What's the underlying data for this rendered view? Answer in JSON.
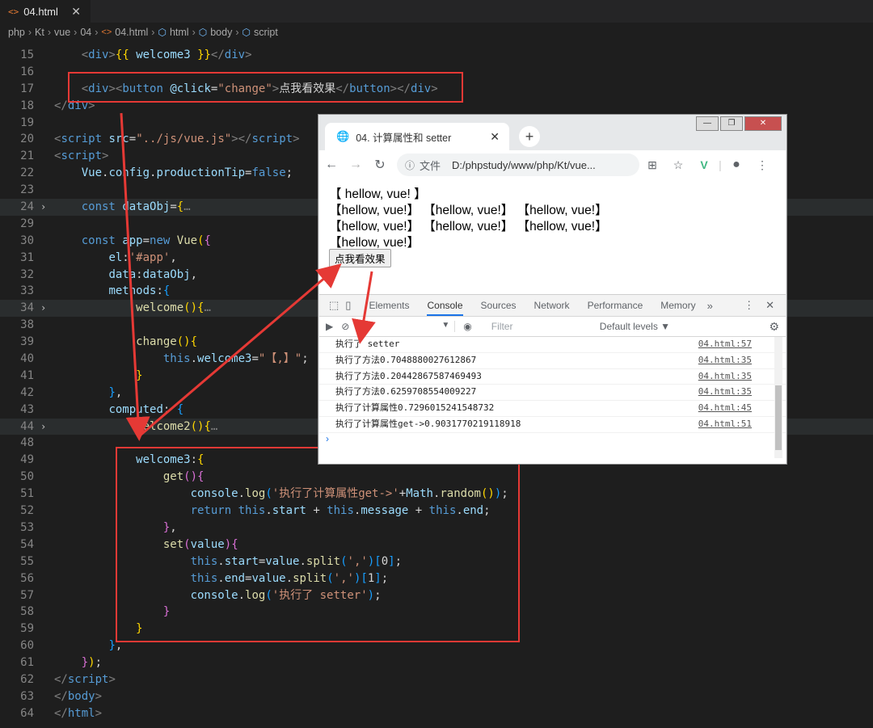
{
  "editor": {
    "tab_label": "04.html",
    "tab_close": "✕",
    "breadcrumb": [
      "php",
      "Kt",
      "vue",
      "04",
      "04.html",
      "html",
      "body",
      "script"
    ]
  },
  "code_lines": [
    {
      "n": "15",
      "fold": "",
      "hl": false,
      "html": "    <span class='tg'>&lt;</span><span class='tn'>div</span><span class='tg'>&gt;</span><span class='br'>{{</span> <span class='id'>welcome3</span> <span class='br'>}}</span><span class='tg'>&lt;/</span><span class='tn'>div</span><span class='tg'>&gt;</span>"
    },
    {
      "n": "16",
      "fold": "",
      "hl": false,
      "html": ""
    },
    {
      "n": "17",
      "fold": "",
      "hl": false,
      "html": "    <span class='tg'>&lt;</span><span class='tn'>div</span><span class='tg'>&gt;&lt;</span><span class='tn'>button</span> <span class='at'>@click</span>=<span class='st'>\"change\"</span><span class='tg'>&gt;</span>点我看效果<span class='tg'>&lt;/</span><span class='tn'>button</span><span class='tg'>&gt;&lt;/</span><span class='tn'>div</span><span class='tg'>&gt;</span>"
    },
    {
      "n": "18",
      "fold": "",
      "hl": false,
      "html": "<span class='tg'>&lt;/</span><span class='tn'>div</span><span class='tg'>&gt;</span>"
    },
    {
      "n": "19",
      "fold": "",
      "hl": false,
      "html": ""
    },
    {
      "n": "20",
      "fold": "",
      "hl": false,
      "html": "<span class='tg'>&lt;</span><span class='tn'>script</span> <span class='at'>src</span>=<span class='st'>\"../js/vue.js\"</span><span class='tg'>&gt;&lt;/</span><span class='tn'>script</span><span class='tg'>&gt;</span>"
    },
    {
      "n": "21",
      "fold": "",
      "hl": false,
      "html": "<span class='tg'>&lt;</span><span class='tn'>script</span><span class='tg'>&gt;</span>"
    },
    {
      "n": "22",
      "fold": "",
      "hl": false,
      "html": "    <span class='id'>Vue</span>.<span class='id'>config</span>.<span class='id'>productionTip</span>=<span class='kw'>false</span>;"
    },
    {
      "n": "23",
      "fold": "",
      "hl": false,
      "html": ""
    },
    {
      "n": "24",
      "fold": "›",
      "hl": true,
      "html": "    <span class='kw'>const</span> <span class='id'>dataObj</span>=<span class='br'>{</span><span class='cm'>…</span>"
    },
    {
      "n": "29",
      "fold": "",
      "hl": false,
      "html": ""
    },
    {
      "n": "30",
      "fold": "",
      "hl": false,
      "html": "    <span class='kw'>const</span> <span class='id'>app</span>=<span class='kw'>new</span> <span class='fn'>Vue</span><span class='br'>(</span><span class='br2'>{</span>"
    },
    {
      "n": "31",
      "fold": "",
      "hl": false,
      "html": "        <span class='id'>el</span>:<span class='st'>'#app'</span>,"
    },
    {
      "n": "32",
      "fold": "",
      "hl": false,
      "html": "        <span class='id'>data</span>:<span class='id'>dataObj</span>,"
    },
    {
      "n": "33",
      "fold": "",
      "hl": false,
      "html": "        <span class='id'>methods</span>:<span class='br3'>{</span>"
    },
    {
      "n": "34",
      "fold": "›",
      "hl": true,
      "html": "            <span class='fn'>welcome</span><span class='br'>()</span><span class='br'>{</span><span class='cm'>…</span>"
    },
    {
      "n": "38",
      "fold": "",
      "hl": false,
      "html": ""
    },
    {
      "n": "39",
      "fold": "",
      "hl": false,
      "html": "            <span class='fn'>change</span><span class='br'>()</span><span class='br'>{</span>"
    },
    {
      "n": "40",
      "fold": "",
      "hl": false,
      "html": "                <span class='kw'>this</span>.<span class='id'>welcome3</span>=<span class='st'>\"【,】\"</span>;"
    },
    {
      "n": "41",
      "fold": "",
      "hl": false,
      "html": "            <span class='br'>}</span>"
    },
    {
      "n": "42",
      "fold": "",
      "hl": false,
      "html": "        <span class='br3'>}</span>,"
    },
    {
      "n": "43",
      "fold": "",
      "hl": false,
      "html": "        <span class='id'>computed</span>: <span class='br3'>{</span>"
    },
    {
      "n": "44",
      "fold": "›",
      "hl": true,
      "html": "            <span class='fn'>welcome2</span><span class='br'>()</span><span class='br'>{</span><span class='cm'>…</span>"
    },
    {
      "n": "48",
      "fold": "",
      "hl": false,
      "html": ""
    },
    {
      "n": "49",
      "fold": "",
      "hl": false,
      "html": "            <span class='id'>welcome3</span>:<span class='br'>{</span>"
    },
    {
      "n": "50",
      "fold": "",
      "hl": false,
      "html": "                <span class='fn'>get</span><span class='br2'>()</span><span class='br2'>{</span>"
    },
    {
      "n": "51",
      "fold": "",
      "hl": false,
      "html": "                    <span class='id'>console</span>.<span class='fn'>log</span><span class='br3'>(</span><span class='st'>'执行了计算属性get-&gt;'</span>+<span class='id'>Math</span>.<span class='fn'>random</span><span class='br'>()</span><span class='br3'>)</span>;"
    },
    {
      "n": "52",
      "fold": "",
      "hl": false,
      "html": "                    <span class='kw'>return</span> <span class='kw'>this</span>.<span class='id'>start</span> + <span class='kw'>this</span>.<span class='id'>message</span> + <span class='kw'>this</span>.<span class='id'>end</span>;"
    },
    {
      "n": "53",
      "fold": "",
      "hl": false,
      "html": "                <span class='br2'>}</span>,"
    },
    {
      "n": "54",
      "fold": "",
      "hl": false,
      "html": "                <span class='fn'>set</span><span class='br2'>(</span><span class='id'>value</span><span class='br2'>)</span><span class='br2'>{</span>"
    },
    {
      "n": "55",
      "fold": "",
      "hl": false,
      "html": "                    <span class='kw'>this</span>.<span class='id'>start</span>=<span class='id'>value</span>.<span class='fn'>split</span><span class='br3'>(</span><span class='st'>','</span><span class='br3'>)</span><span class='br3'>[</span>0<span class='br3'>]</span>;"
    },
    {
      "n": "56",
      "fold": "",
      "hl": false,
      "html": "                    <span class='kw'>this</span>.<span class='id'>end</span>=<span class='id'>value</span>.<span class='fn'>split</span><span class='br3'>(</span><span class='st'>','</span><span class='br3'>)</span><span class='br3'>[</span>1<span class='br3'>]</span>;"
    },
    {
      "n": "57",
      "fold": "",
      "hl": false,
      "html": "                    <span class='id'>console</span>.<span class='fn'>log</span><span class='br3'>(</span><span class='st'>'执行了 setter'</span><span class='br3'>)</span>;"
    },
    {
      "n": "58",
      "fold": "",
      "hl": false,
      "html": "                <span class='br2'>}</span>"
    },
    {
      "n": "59",
      "fold": "",
      "hl": false,
      "html": "            <span class='br'>}</span>"
    },
    {
      "n": "60",
      "fold": "",
      "hl": false,
      "html": "        <span class='br3'>}</span>,"
    },
    {
      "n": "61",
      "fold": "",
      "hl": false,
      "html": "    <span class='br2'>}</span><span class='br'>)</span>;"
    },
    {
      "n": "62",
      "fold": "",
      "hl": false,
      "html": "<span class='tg'>&lt;/</span><span class='tn'>script</span><span class='tg'>&gt;</span>"
    },
    {
      "n": "63",
      "fold": "",
      "hl": false,
      "html": "<span class='tg'>&lt;/</span><span class='tn'>body</span><span class='tg'>&gt;</span>"
    },
    {
      "n": "64",
      "fold": "",
      "hl": false,
      "html": "<span class='tg'>&lt;/</span><span class='tn'>html</span><span class='tg'>&gt;</span>"
    }
  ],
  "browser": {
    "tab_title": "04. 计算属性和 setter",
    "new_tab": "+",
    "win_controls": [
      "—",
      "❐",
      "✕"
    ],
    "file_label": "文件",
    "url": "D:/phpstudy/www/php/Kt/vue...",
    "page_lines": [
      "【 hellow, vue! 】",
      "【hellow, vue!】 【hellow, vue!】 【hellow, vue!】",
      "【hellow, vue!】 【hellow, vue!】 【hellow, vue!】",
      "【hellow, vue!】"
    ],
    "page_button": "点我看效果"
  },
  "devtools": {
    "tabs": [
      "Elements",
      "Console",
      "Sources",
      "Network",
      "Performance",
      "Memory"
    ],
    "active_tab": "Console",
    "more": "»",
    "context": "top",
    "filter_placeholder": "Filter",
    "levels": "Default levels ▼",
    "console": [
      {
        "msg": "执行了 setter",
        "src": "04.html:57"
      },
      {
        "msg": "执行了方法0.7048880027612867",
        "src": "04.html:35"
      },
      {
        "msg": "执行了方法0.20442867587469493",
        "src": "04.html:35"
      },
      {
        "msg": "执行了方法0.6259708554009227",
        "src": "04.html:35"
      },
      {
        "msg": "执行了计算属性0.7296015241548732",
        "src": "04.html:45"
      },
      {
        "msg": "执行了计算属性get->0.9031770219118918",
        "src": "04.html:51"
      }
    ],
    "prompt": "›"
  },
  "colors": {
    "annotation": "#e53935",
    "editor_bg": "#1e1e1e"
  }
}
